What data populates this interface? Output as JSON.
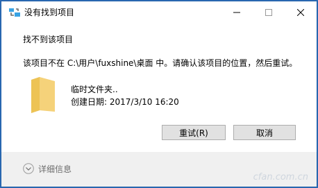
{
  "dialog": {
    "title": "没有找到项目",
    "heading": "找不到该项目",
    "message": "该项目不在 C:\\用户\\fuxshine\\桌面 中。请确认该项目的位置，然后重试。",
    "file": {
      "name": "临时文件夹..",
      "created": "创建日期: 2017/3/10 16:20",
      "icon": "folder-icon"
    },
    "buttons": {
      "retry": "重试(R)",
      "cancel": "取消"
    },
    "details_label": "详细信息"
  },
  "titlebar_controls": [
    "minimize-icon",
    "maximize-icon",
    "close-icon"
  ],
  "watermark": "cfan.com.cn",
  "colors": {
    "frame": "#2d6bb5",
    "button_bg": "#e1e1e1",
    "folder": "#f5d27a"
  }
}
